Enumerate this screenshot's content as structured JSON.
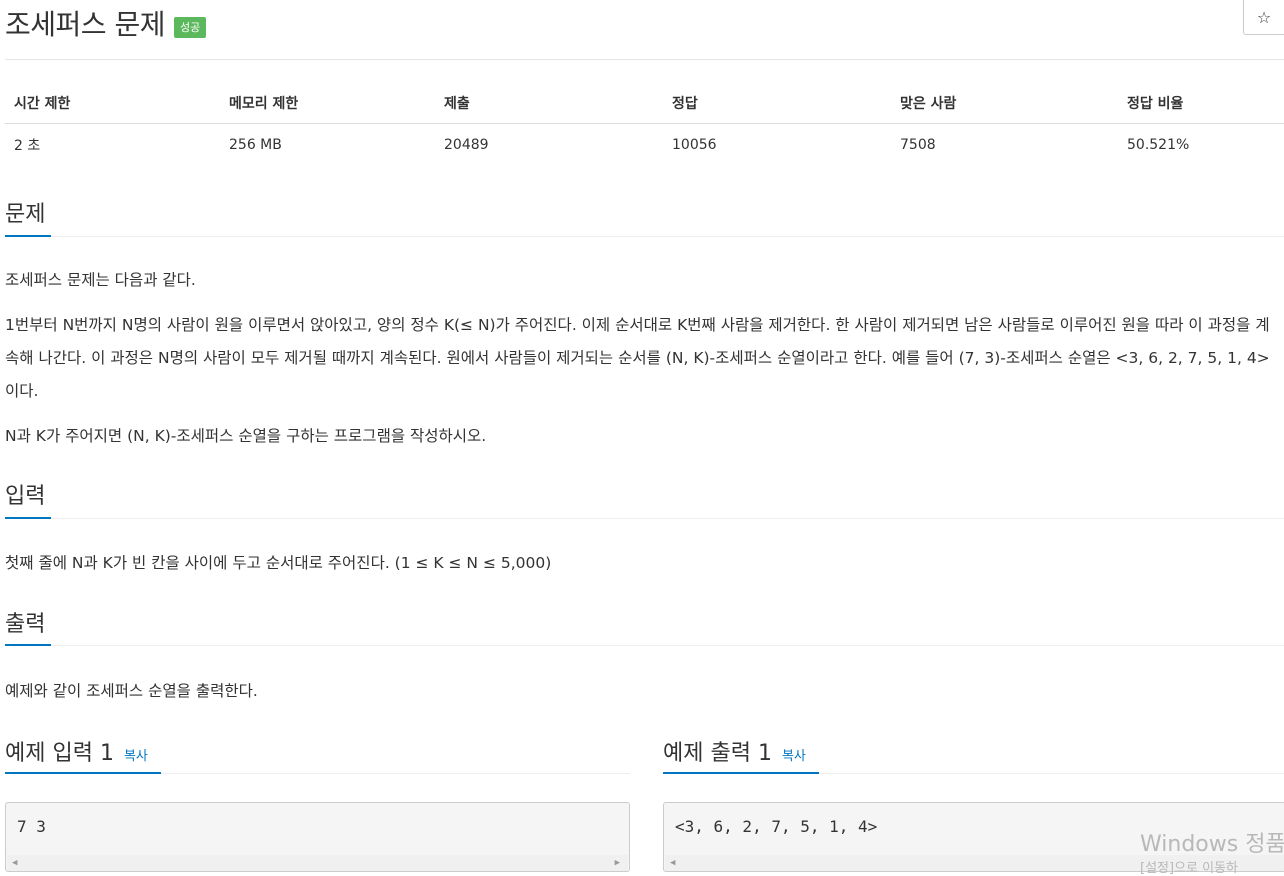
{
  "header": {
    "title": "조세퍼스 문제",
    "badge": "성공",
    "star": "☆"
  },
  "stats": {
    "headers": [
      "시간 제한",
      "메모리 제한",
      "제출",
      "정답",
      "맞은 사람",
      "정답 비율"
    ],
    "values": [
      "2 초",
      "256 MB",
      "20489",
      "10056",
      "7508",
      "50.521%"
    ]
  },
  "problem": {
    "heading": "문제",
    "p1": "조세퍼스 문제는 다음과 같다.",
    "p2": "1번부터 N번까지 N명의 사람이 원을 이루면서 앉아있고, 양의 정수 K(≤ N)가 주어진다. 이제 순서대로 K번째 사람을 제거한다. 한 사람이 제거되면 남은 사람들로 이루어진 원을 따라 이 과정을 계속해 나간다. 이 과정은 N명의 사람이 모두 제거될 때까지 계속된다. 원에서 사람들이 제거되는 순서를 (N, K)-조세퍼스 순열이라고 한다. 예를 들어 (7, 3)-조세퍼스 순열은 <3, 6, 2, 7, 5, 1, 4>이다.",
    "p3": "N과 K가 주어지면 (N, K)-조세퍼스 순열을 구하는 프로그램을 작성하시오."
  },
  "input": {
    "heading": "입력",
    "text": "첫째 줄에 N과 K가 빈 칸을 사이에 두고 순서대로 주어진다. (1 ≤ K ≤ N ≤ 5,000)"
  },
  "output": {
    "heading": "출력",
    "text": "예제와 같이 조세퍼스 순열을 출력한다."
  },
  "samples": {
    "input_heading": "예제 입력 1",
    "output_heading": "예제 출력 1",
    "copy_label": "복사",
    "input_text": "7 3",
    "output_text": "<3, 6, 2, 7, 5, 1, 4>"
  },
  "watermark": {
    "line1": "Windows 정품",
    "line2": "[설정]으로 이동하"
  }
}
